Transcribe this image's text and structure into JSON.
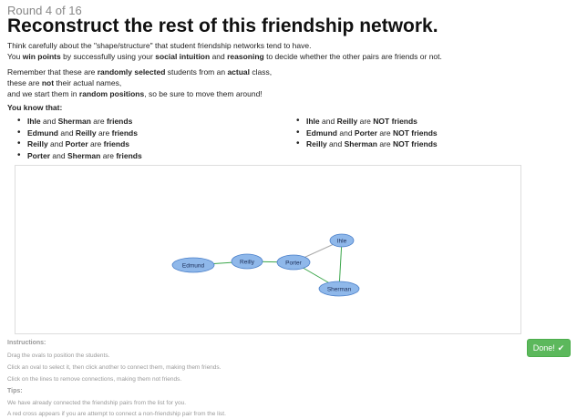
{
  "header": {
    "round": "Round 4 of 16",
    "title": "Reconstruct the rest of this friendship network."
  },
  "intro": {
    "line1": "Think carefully about the \"shape/structure\" that student friendship networks tend to have.",
    "line2_a": "You ",
    "line2_b": "win points",
    "line2_c": " by successfully using your ",
    "line2_d": "social intuition",
    "line2_e": " and ",
    "line2_f": "reasoning",
    "line2_g": " to decide whether the other pairs are friends or not.",
    "line3_a": "Remember that these are ",
    "line3_b": "randomly selected",
    "line3_c": " students from an ",
    "line3_d": "actual",
    "line3_e": " class,",
    "line4_a": "these are ",
    "line4_b": "not",
    "line4_c": " their actual names,",
    "line5_a": "and we start them in ",
    "line5_b": "random positions",
    "line5_c": ", so be sure to move them around!"
  },
  "you_know": "You know that:",
  "and_word": " and ",
  "are_word": " are ",
  "friends_word": "friends",
  "not_friends_word": "NOT friends",
  "friend_pairs": [
    {
      "a": "Ihle",
      "b": "Sherman"
    },
    {
      "a": "Edmund",
      "b": "Reilly"
    },
    {
      "a": "Reilly",
      "b": "Porter"
    },
    {
      "a": "Porter",
      "b": "Sherman"
    }
  ],
  "nonfriend_pairs": [
    {
      "a": "Ihle",
      "b": "Reilly"
    },
    {
      "a": "Edmund",
      "b": "Porter"
    },
    {
      "a": "Reilly",
      "b": "Sherman"
    }
  ],
  "network": {
    "nodes": [
      "Edmund",
      "Reilly",
      "Porter",
      "Ihle",
      "Sherman"
    ],
    "edges": [
      {
        "from": "Edmund",
        "to": "Reilly",
        "status": "friend"
      },
      {
        "from": "Reilly",
        "to": "Porter",
        "status": "friend"
      },
      {
        "from": "Porter",
        "to": "Ihle",
        "status": "unknown"
      },
      {
        "from": "Porter",
        "to": "Sherman",
        "status": "friend"
      },
      {
        "from": "Ihle",
        "to": "Sherman",
        "status": "friend"
      }
    ],
    "colors": {
      "node_fill": "#8fb8ea",
      "node_stroke": "#4a7fc9",
      "friend_edge": "#3aa64a",
      "unknown_edge": "#aaaaaa"
    }
  },
  "instructions": {
    "heading": "Instructions:",
    "lines": [
      "Drag the ovals to position the students.",
      "Click an oval to select it, then click another to connect them, making them friends.",
      "Click on the lines to remove connections, making them not friends."
    ]
  },
  "tips": {
    "heading": "Tips:",
    "lines": [
      "We have already connected the friendship pairs from the list for you.",
      "A red cross appears if you are attempt to connect a non-friendship pair from the list."
    ]
  },
  "done_button": {
    "label": "Done!",
    "color": "#5cb85c"
  }
}
